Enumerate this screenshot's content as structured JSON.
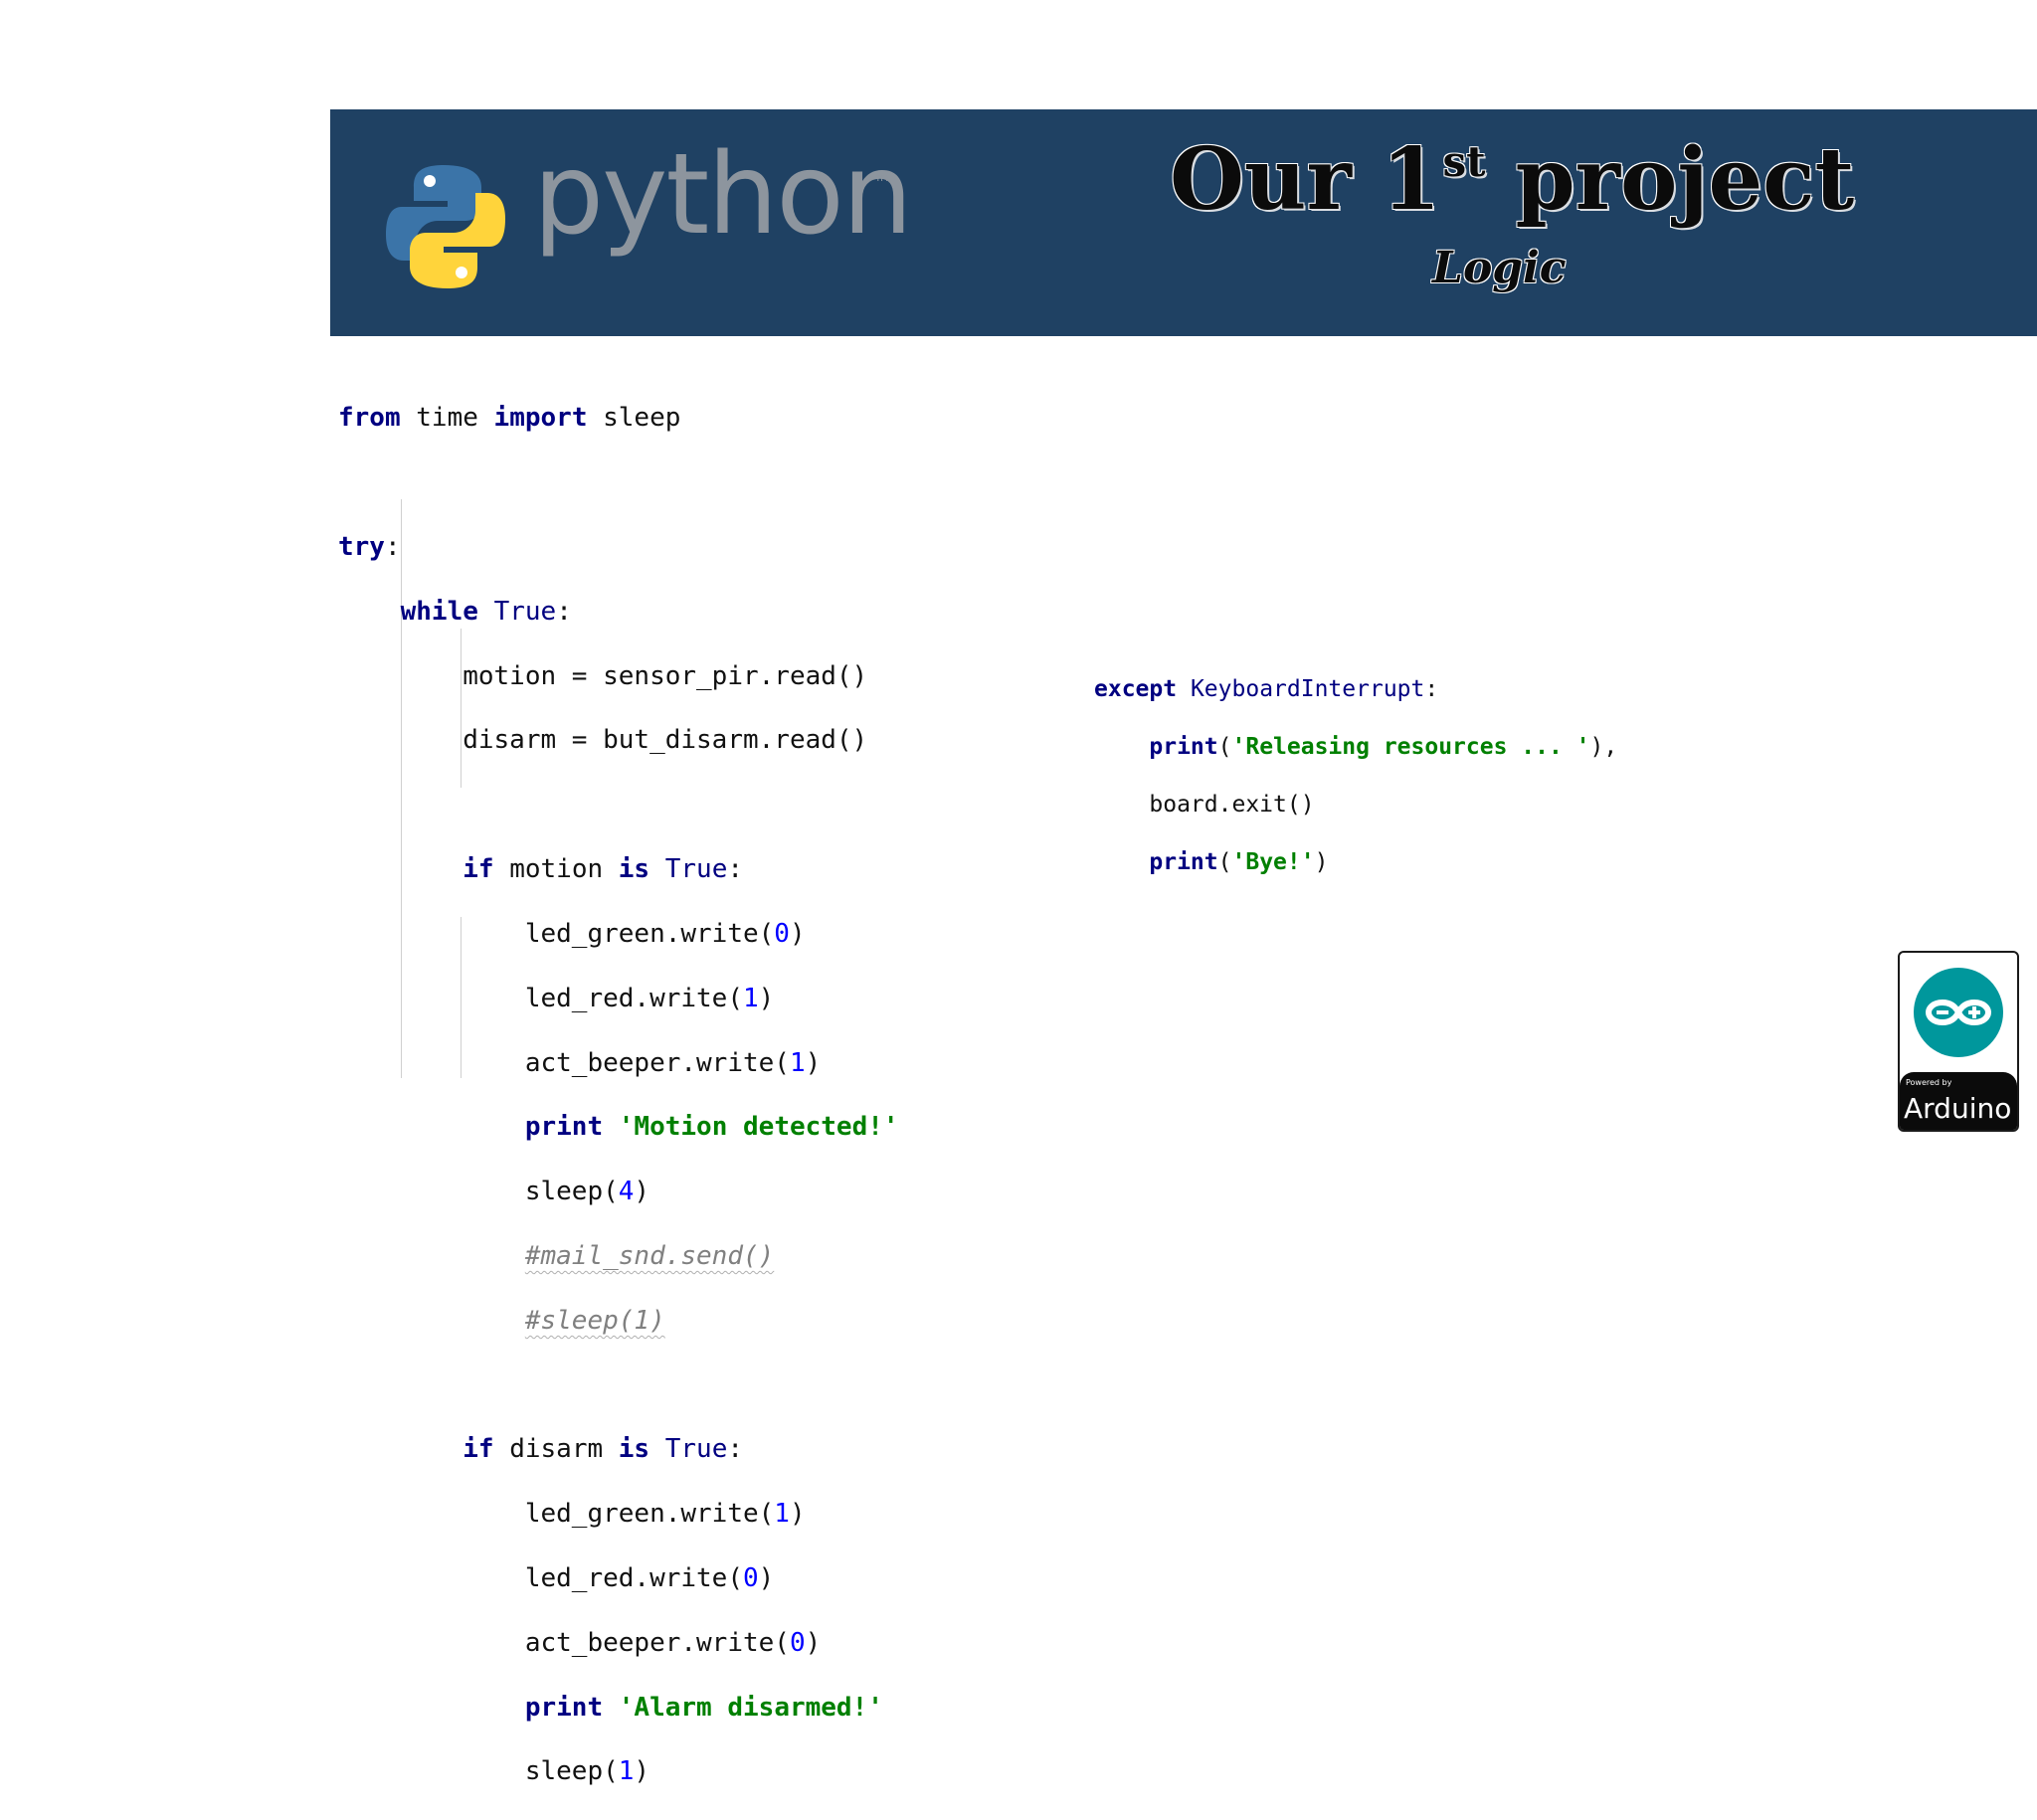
{
  "banner": {
    "logo_text": "python",
    "logo_tm": "™",
    "title_main": "Our 1",
    "title_sup": "st",
    "title_rest": " project",
    "subtitle": "Logic",
    "colors": {
      "background": "#1f4163",
      "python_blue": "#3b74a8",
      "python_yellow": "#ffd43b"
    }
  },
  "code_main": {
    "l1": [
      "from",
      " time ",
      "import",
      " sleep"
    ],
    "l2": [
      "try",
      ":"
    ],
    "l3": [
      "    ",
      "while",
      " ",
      "True",
      ":"
    ],
    "l4": "        motion = sensor_pir.read()",
    "l5": "        disarm = but_disarm.read()",
    "l6": [
      "        ",
      "if",
      " motion ",
      "is",
      " ",
      "True",
      ":"
    ],
    "l7": [
      "            led_green.write(",
      "0",
      ")"
    ],
    "l8": [
      "            led_red.write(",
      "1",
      ")"
    ],
    "l9": [
      "            act_beeper.write(",
      "1",
      ")"
    ],
    "l10": [
      "            ",
      "print",
      " ",
      "'Motion detected!'"
    ],
    "l11": [
      "            sleep(",
      "4",
      ")"
    ],
    "l12": [
      "            ",
      "#mail_snd.send()"
    ],
    "l13": [
      "            ",
      "#sleep(1)"
    ],
    "l14": [
      "        ",
      "if",
      " disarm ",
      "is",
      " ",
      "True",
      ":"
    ],
    "l15": [
      "            led_green.write(",
      "1",
      ")"
    ],
    "l16": [
      "            led_red.write(",
      "0",
      ")"
    ],
    "l17": [
      "            act_beeper.write(",
      "0",
      ")"
    ],
    "l18": [
      "            ",
      "print",
      " ",
      "'Alarm disarmed!'"
    ],
    "l19": [
      "            sleep(",
      "1",
      ")"
    ]
  },
  "code_except": {
    "l1": [
      "except",
      " ",
      "KeyboardInterrupt",
      ":"
    ],
    "l2": [
      "    ",
      "print",
      "(",
      "'Releasing resources ... '",
      "),"
    ],
    "l3": "    board.exit()",
    "l4": [
      "    ",
      "print",
      "(",
      "'Bye!'",
      ")"
    ]
  },
  "arduino_badge": {
    "powered_by": "Powered by",
    "name": "Arduino",
    "colors": {
      "teal": "#00979c"
    }
  }
}
